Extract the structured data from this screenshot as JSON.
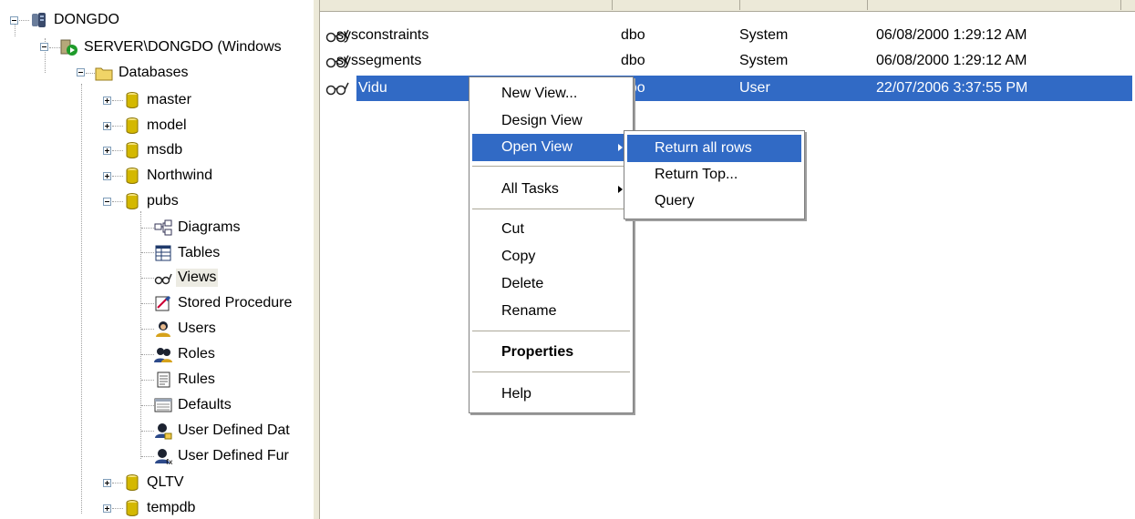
{
  "tree": {
    "root": "DONGDO",
    "server": "SERVER\\DONGDO (Windows",
    "databases_label": "Databases",
    "databases": [
      "master",
      "model",
      "msdb",
      "Northwind",
      "pubs"
    ],
    "pubs_children": [
      "Diagrams",
      "Tables",
      "Views",
      "Stored Procedure",
      "Users",
      "Roles",
      "Rules",
      "Defaults",
      "User Defined Dat",
      "User Defined Fur"
    ],
    "more_databases": [
      "QLTV",
      "tempdb"
    ]
  },
  "list": {
    "rows": [
      {
        "name": "sysconstraints",
        "owner": "dbo",
        "type": "System",
        "created": "06/08/2000 1:29:12 AM"
      },
      {
        "name": "syssegments",
        "owner": "dbo",
        "type": "System",
        "created": "06/08/2000 1:29:12 AM"
      },
      {
        "name": "Vidu",
        "owner": "dbo",
        "type": "User",
        "created": "22/07/2006 3:37:55 PM"
      }
    ]
  },
  "context_menu": {
    "items": {
      "new_view": "New View...",
      "design_view": "Design View",
      "open_view": "Open View",
      "all_tasks": "All Tasks",
      "cut": "Cut",
      "copy": "Copy",
      "delete": "Delete",
      "rename": "Rename",
      "properties": "Properties",
      "help": "Help"
    }
  },
  "submenu": {
    "items": {
      "return_all_rows": "Return all rows",
      "return_top": "Return Top...",
      "query": "Query"
    }
  },
  "colors": {
    "selection": "#316ac5",
    "menu_border": "#808080",
    "db_icon": "#d4b800"
  }
}
